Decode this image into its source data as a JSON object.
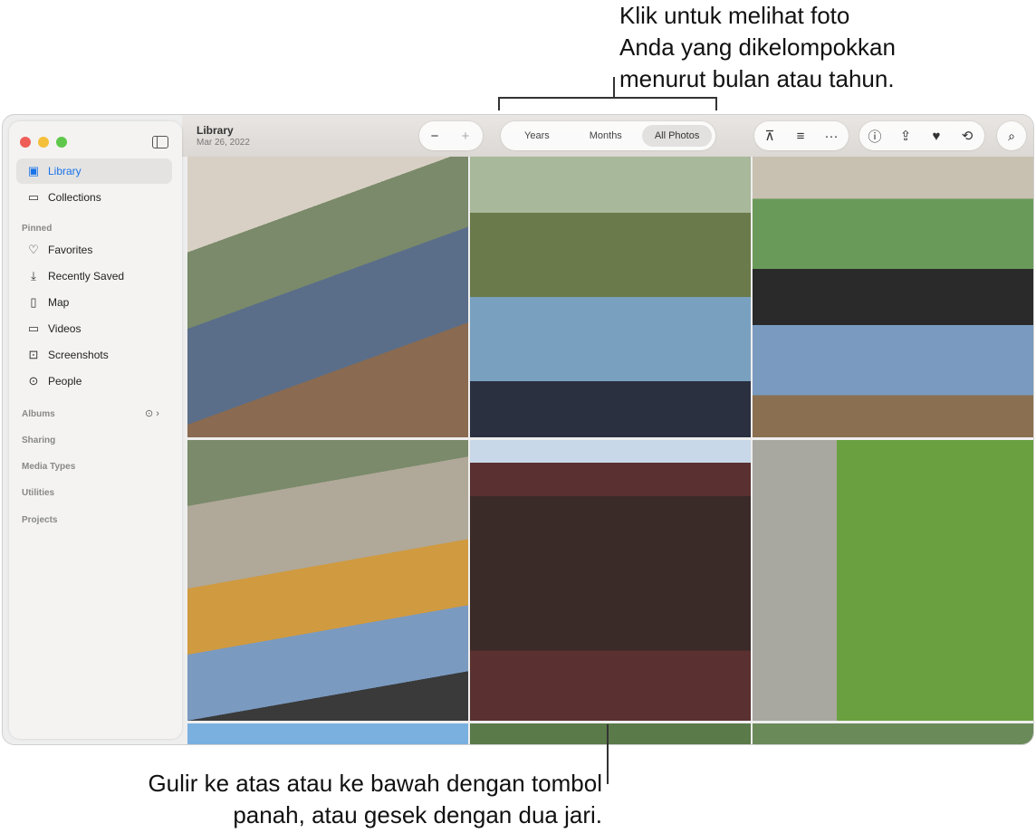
{
  "callouts": {
    "top": [
      "Klik untuk melihat foto",
      "Anda yang dikelompokkan",
      "menurut bulan atau tahun."
    ],
    "bottom": [
      "Gulir ke atas atau ke bawah dengan tombol",
      "panah, atau gesek dengan dua jari."
    ]
  },
  "header": {
    "title": "Library",
    "date": "Mar 26, 2022"
  },
  "view_tabs": [
    {
      "label": "Years"
    },
    {
      "label": "Months"
    },
    {
      "label": "All Photos",
      "selected": true
    }
  ],
  "sidebar": {
    "top": [
      {
        "label": "Library",
        "icon": "photo-library-icon"
      },
      {
        "label": "Collections",
        "icon": "collections-icon"
      }
    ],
    "pinned_heading": "Pinned",
    "pinned": [
      {
        "label": "Favorites",
        "icon": "heart-icon"
      },
      {
        "label": "Recently Saved",
        "icon": "download-clock-icon"
      },
      {
        "label": "Map",
        "icon": "map-icon"
      },
      {
        "label": "Videos",
        "icon": "video-icon"
      },
      {
        "label": "Screenshots",
        "icon": "screenshot-icon"
      },
      {
        "label": "People",
        "icon": "people-icon"
      }
    ],
    "sections": [
      "Albums",
      "Sharing",
      "Media Types",
      "Utilities",
      "Projects"
    ]
  },
  "colors": {
    "accent": "#1a73e8"
  }
}
